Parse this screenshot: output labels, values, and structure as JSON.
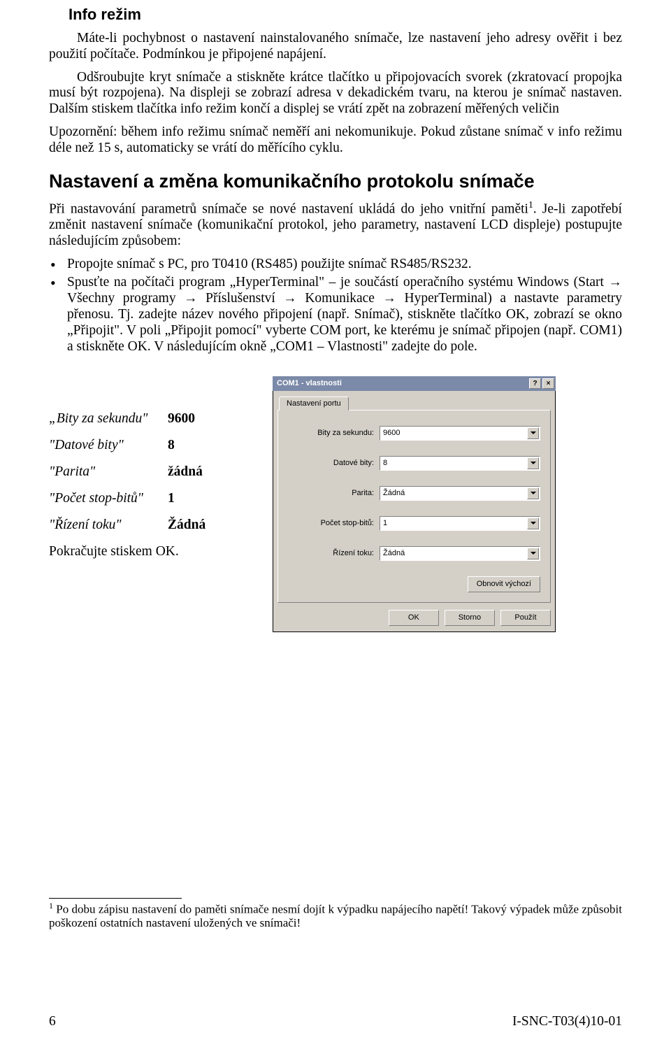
{
  "section1": {
    "heading": "Info režim",
    "p1": "Máte-li pochybnost o nastavení nainstalovaného snímače, lze nastavení jeho adresy ověřit i bez použití počítače. Podmínkou je připojené napájení.",
    "p2": "Odšroubujte kryt snímače a stiskněte krátce tlačítko u připojovacích svorek (zkratovací propojka musí být rozpojena). Na displeji se zobrazí adresa v dekadickém tvaru, na kterou je snímač nastaven. Dalším stiskem tlačítka info režim končí a displej se vrátí zpět na zobrazení měřených veličin",
    "p3": "Upozornění: během info režimu snímač neměří ani nekomunikuje. Pokud zůstane snímač v info režimu déle než 15 s, automaticky se vrátí do měřícího cyklu."
  },
  "section2": {
    "heading": "Nastavení a změna komunikačního protokolu snímače",
    "intro_a": "Při nastavování parametrů snímače se nové nastavení ukládá do jeho vnitřní paměti",
    "intro_b": ". Je-li zapotřebí změnit nastavení snímače (komunikační protokol, jeho parametry, nastavení LCD displeje) postupujte následujícím způsobem:",
    "bullet1": "Propojte snímač s PC, pro T0410 (RS485) použijte snímač RS485/RS232.",
    "bullet2": "Spusťte na počítači program „HyperTerminal\" – je součástí operačního systému Windows (Start → Všechny programy → Příslušenství → Komunikace → HyperTerminal) a nastavte parametry přenosu. Tj. zadejte název nového připojení (např. Snímač), stiskněte tlačítko OK, zobrazí se okno „Připojit\". V poli „Připojit pomocí\" vyberte COM port, ke kterému je snímač připojen (např. COM1) a stiskněte OK. V následujícím okně „COM1 – Vlastnosti\" zadejte do pole."
  },
  "settings": {
    "r1l": "„Bity za sekundu\"",
    "r1v": "9600",
    "r2l": "\"Datové bity\"",
    "r2v": "8",
    "r3l": "\"Parita\"",
    "r3v": "žádná",
    "r4l": "\"Počet stop-bitů\"",
    "r4v": "1",
    "r5l": "\"Řízení toku\"",
    "r5v": "Žádná",
    "cont": "Pokračujte stiskem OK."
  },
  "dialog": {
    "title": "COM1 - vlastnosti",
    "help_btn": "?",
    "close_btn": "×",
    "tab": "Nastavení portu",
    "f1l": "Bity za sekundu:",
    "f1v": "9600",
    "f2l": "Datové bity:",
    "f2v": "8",
    "f3l": "Parita:",
    "f3v": "Žádná",
    "f4l": "Počet stop-bitů:",
    "f4v": "1",
    "f5l": "Řízení toku:",
    "f5v": "Žádná",
    "restore": "Obnovit výchozí",
    "ok": "OK",
    "cancel": "Storno",
    "apply": "Použít"
  },
  "footnote": {
    "marker": "1",
    "text": " Po dobu zápisu nastavení do paměti snímače nesmí dojít k výpadku napájecího napětí! Takový výpadek může způsobit poškození ostatních nastavení uložených ve snímači!"
  },
  "footer": {
    "page": "6",
    "doc": "I-SNC-T03(4)10-01"
  }
}
